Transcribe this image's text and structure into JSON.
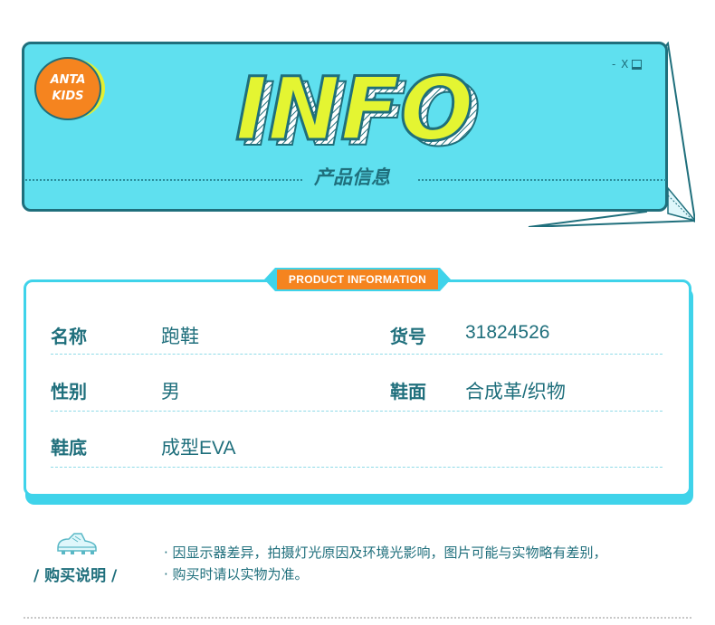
{
  "header": {
    "logo_line1": "ANTA",
    "logo_line2": "KIDS",
    "window_controls": "- X",
    "title": "INFO",
    "subtitle": "产品信息"
  },
  "card": {
    "label": "PRODUCT INFORMATION",
    "rows": [
      {
        "label": "名称",
        "value": "跑鞋",
        "label2": "货号",
        "value2": "31824526"
      },
      {
        "label": "性别",
        "value": "男",
        "label2": "鞋面",
        "value2": "合成革/织物"
      },
      {
        "label": "鞋底",
        "value": "成型EVA"
      }
    ]
  },
  "purchase": {
    "title": "/ 购买说明 /",
    "notes": [
      "· 因显示器差异，拍摄灯光原因及环境光影响，图片可能与实物略有差别，",
      "· 购买时请以实物为准。"
    ]
  },
  "colors": {
    "banner": "#5fe0ef",
    "dark_teal": "#1f6f7c",
    "accent_orange": "#f5841f",
    "title_yellow": "#e4f532",
    "card_border": "#3fd3ea"
  }
}
